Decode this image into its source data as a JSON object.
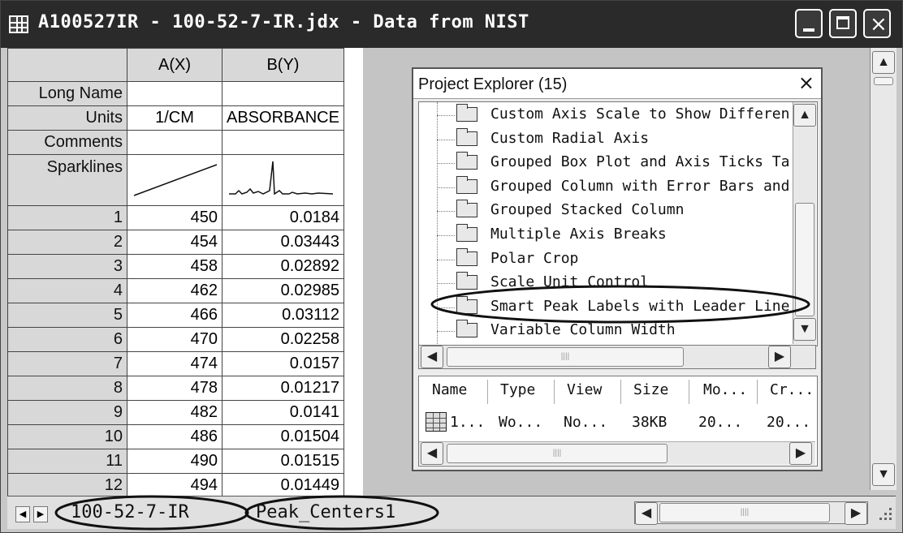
{
  "window": {
    "title": "A100527IR - 100-52-7-IR.jdx - Data from NIST",
    "close_glyph": "×"
  },
  "worksheet": {
    "col_headers": [
      "A(X)",
      "B(Y)"
    ],
    "label_rows": [
      {
        "label": "Long Name",
        "a": "",
        "b": ""
      },
      {
        "label": "Units",
        "a": "1/CM",
        "b": "ABSORBANCE"
      },
      {
        "label": "Comments",
        "a": "",
        "b": ""
      }
    ],
    "sparklines_label": "Sparklines",
    "rows": [
      {
        "n": "1",
        "a": "450",
        "b": "0.0184"
      },
      {
        "n": "2",
        "a": "454",
        "b": "0.03443"
      },
      {
        "n": "3",
        "a": "458",
        "b": "0.02892"
      },
      {
        "n": "4",
        "a": "462",
        "b": "0.02985"
      },
      {
        "n": "5",
        "a": "466",
        "b": "0.03112"
      },
      {
        "n": "6",
        "a": "470",
        "b": "0.02258"
      },
      {
        "n": "7",
        "a": "474",
        "b": "0.0157"
      },
      {
        "n": "8",
        "a": "478",
        "b": "0.01217"
      },
      {
        "n": "9",
        "a": "482",
        "b": "0.0141"
      },
      {
        "n": "10",
        "a": "486",
        "b": "0.01504"
      },
      {
        "n": "11",
        "a": "490",
        "b": "0.01515"
      },
      {
        "n": "12",
        "a": "494",
        "b": "0.01449"
      }
    ]
  },
  "project_explorer": {
    "title": "Project Explorer (15)",
    "close_glyph": "×",
    "items": [
      "Custom Axis Scale to Show Differen",
      "Custom Radial Axis",
      "Grouped Box Plot and Axis Ticks Ta",
      "Grouped Column with Error Bars and",
      "Grouped Stacked Column",
      "Multiple Axis Breaks",
      "Polar Crop",
      "Scale Unit Control",
      "Smart Peak Labels with Leader Line",
      "Variable Column Width"
    ],
    "list_headers": [
      "Name",
      "Type",
      "View",
      "Size",
      "Mo...",
      "Cr..."
    ],
    "list_row": [
      "1...",
      "Wo...",
      "No...",
      "38KB",
      "20...",
      "20..."
    ]
  },
  "sheet_tabs": [
    "100-52-7-IR",
    "Peak_Centers1"
  ],
  "icons": {
    "tab_prev": "◀",
    "tab_next": "▶",
    "scroll_up": "▲",
    "scroll_down": "▼",
    "scroll_left": "◀",
    "scroll_right": "▶"
  }
}
